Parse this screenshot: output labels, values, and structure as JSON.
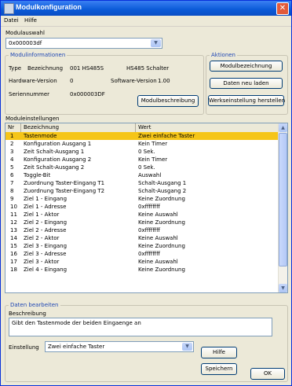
{
  "window": {
    "title": "Modulkonfiguration"
  },
  "menu": {
    "datei": "Datei",
    "hilfe": "Hilfe"
  },
  "modulauswahl": {
    "label": "Modulauswahl",
    "value": "0x000003df"
  },
  "modulinformationen": {
    "title": "Modulinformationen",
    "type_label": "Type",
    "bezeichnung_label": "Bezeichnung",
    "type_value": "001 HS485S",
    "bezeichnung_value": "HS485 Schalter",
    "hw_label": "Hardware-Version",
    "hw_value": "0",
    "sw_label": "Software-Version",
    "sw_value": "1.00",
    "sn_label": "Seriennummer",
    "sn_value": "0x000003DF",
    "beschreibung_button": "Modulbeschreibung"
  },
  "aktionen": {
    "title": "Aktionen",
    "modulbezeichnung_button": "Modulbezeichnung",
    "daten_neu_laden_button": "Daten neu laden",
    "werkseinstellung_button": "Werkseinstellung herstellen"
  },
  "moduleinstellungen": {
    "title": "Moduleinstellungen",
    "columns": [
      "Nr",
      "Bezeichnung",
      "Wert"
    ],
    "rows": [
      {
        "nr": "1",
        "bez": "Tastenmode",
        "wert": "Zwei einfache Taster"
      },
      {
        "nr": "2",
        "bez": "Konfiguration Ausgang 1",
        "wert": "Kein Timer"
      },
      {
        "nr": "3",
        "bez": "Zeit Schalt-Ausgang 1",
        "wert": "0 Sek."
      },
      {
        "nr": "4",
        "bez": "Konfiguration Ausgang 2",
        "wert": "Kein Timer"
      },
      {
        "nr": "5",
        "bez": "Zeit Schalt-Ausgang 2",
        "wert": "0 Sek."
      },
      {
        "nr": "6",
        "bez": "Toggle-Bit",
        "wert": "Auswahl"
      },
      {
        "nr": "7",
        "bez": "Zuordnung Taster-Eingang T1",
        "wert": "Schalt-Ausgang 1"
      },
      {
        "nr": "8",
        "bez": "Zuordnung Taster-Eingang T2",
        "wert": "Schalt-Ausgang 2"
      },
      {
        "nr": "9",
        "bez": "Ziel 1 - Eingang",
        "wert": "Keine Zuordnung"
      },
      {
        "nr": "10",
        "bez": "Ziel 1 - Adresse",
        "wert": "0xffffffff"
      },
      {
        "nr": "11",
        "bez": "Ziel 1 - Aktor",
        "wert": "Keine Auswahl"
      },
      {
        "nr": "12",
        "bez": "Ziel 2 - Eingang",
        "wert": "Keine Zuordnung"
      },
      {
        "nr": "13",
        "bez": "Ziel 2 - Adresse",
        "wert": "0xffffffff"
      },
      {
        "nr": "14",
        "bez": "Ziel 2 - Aktor",
        "wert": "Keine Auswahl"
      },
      {
        "nr": "15",
        "bez": "Ziel 3 - Eingang",
        "wert": "Keine Zuordnung"
      },
      {
        "nr": "16",
        "bez": "Ziel 3 - Adresse",
        "wert": "0xffffffff"
      },
      {
        "nr": "17",
        "bez": "Ziel 3 - Aktor",
        "wert": "Keine Auswahl"
      },
      {
        "nr": "18",
        "bez": "Ziel 4 - Eingang",
        "wert": "Keine Zuordnung"
      }
    ]
  },
  "daten_bearbeiten": {
    "title": "Daten bearbeiten",
    "beschreibung_label": "Beschreibung",
    "beschreibung_text": "Gibt den Tastenmode der beiden Eingaenge an",
    "einstellung_label": "Einstellung",
    "einstellung_value": "Zwei einfache Taster",
    "hilfe_button": "Hilfe",
    "speichern_button": "Speichern"
  },
  "ok_button": "OK",
  "colors": {
    "selection": "#f5c518",
    "titlebar": "#0a5ad7",
    "group_title": "#1e46b4"
  }
}
